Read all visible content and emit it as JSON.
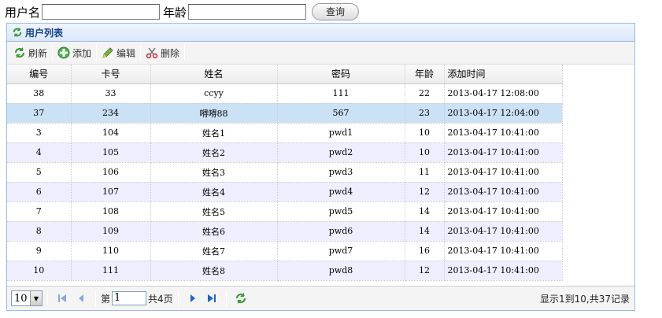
{
  "search": {
    "username_label": "用户名",
    "username_value": "",
    "age_label": "年龄",
    "age_value": "",
    "query_button": "查询"
  },
  "panel": {
    "title": "用户列表",
    "toolbar": [
      {
        "label": "刷新",
        "icon": "refresh-icon"
      },
      {
        "label": "添加",
        "icon": "add-icon"
      },
      {
        "label": "编辑",
        "icon": "edit-icon"
      },
      {
        "label": "删除",
        "icon": "delete-icon"
      }
    ]
  },
  "grid": {
    "columns": [
      "编号",
      "卡号",
      "姓名",
      "密码",
      "年龄",
      "添加时间"
    ],
    "rows": [
      [
        "38",
        "33",
        "ccyy",
        "111",
        "22",
        "2013-04-17 12:08:00"
      ],
      [
        "37",
        "234",
        "嘚嘚88",
        "567",
        "23",
        "2013-04-17 12:04:00"
      ],
      [
        "3",
        "104",
        "姓名1",
        "pwd1",
        "10",
        "2013-04-17 10:41:00"
      ],
      [
        "4",
        "105",
        "姓名2",
        "pwd2",
        "10",
        "2013-04-17 10:41:00"
      ],
      [
        "5",
        "106",
        "姓名3",
        "pwd3",
        "11",
        "2013-04-17 10:41:00"
      ],
      [
        "6",
        "107",
        "姓名4",
        "pwd4",
        "12",
        "2013-04-17 10:41:00"
      ],
      [
        "7",
        "108",
        "姓名5",
        "pwd5",
        "14",
        "2013-04-17 10:41:00"
      ],
      [
        "8",
        "109",
        "姓名6",
        "pwd6",
        "14",
        "2013-04-17 10:41:00"
      ],
      [
        "9",
        "110",
        "姓名7",
        "pwd7",
        "16",
        "2013-04-17 10:41:00"
      ],
      [
        "10",
        "111",
        "姓名8",
        "pwd8",
        "12",
        "2013-04-17 10:41:00"
      ]
    ],
    "selected_row": 1
  },
  "pager": {
    "page_size": "10",
    "page_prefix": "第",
    "current_page": "1",
    "total_pages_text": "共4页",
    "info": "显示1到10,共37记录"
  },
  "colors": {
    "panel_border": "#99bbe8",
    "title_color": "#15428b",
    "alt_row": "#eeeeff",
    "selected_row": "#cbe1f5"
  }
}
